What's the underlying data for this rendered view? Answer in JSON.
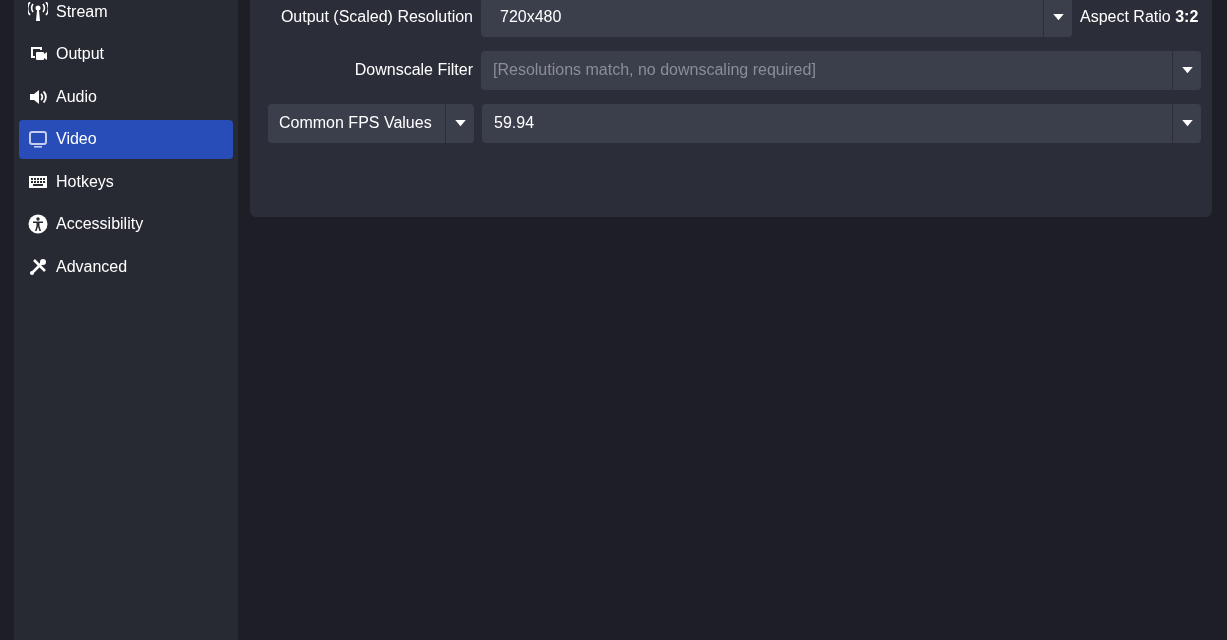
{
  "sidebar": {
    "items": [
      {
        "label": "Stream",
        "selected": false
      },
      {
        "label": "Output",
        "selected": false
      },
      {
        "label": "Audio",
        "selected": false
      },
      {
        "label": "Video",
        "selected": true
      },
      {
        "label": "Hotkeys",
        "selected": false
      },
      {
        "label": "Accessibility",
        "selected": false
      },
      {
        "label": "Advanced",
        "selected": false
      }
    ]
  },
  "settings": {
    "output_resolution": {
      "label": "Output (Scaled) Resolution",
      "value": "720x480",
      "aspect_ratio": "Aspect Ratio **3:2**"
    },
    "downscale_filter": {
      "label": "Downscale Filter",
      "value": "[Resolutions match, no downscaling required]",
      "disabled": true
    },
    "fps": {
      "type": "Common FPS Values",
      "value": "59.94"
    }
  }
}
